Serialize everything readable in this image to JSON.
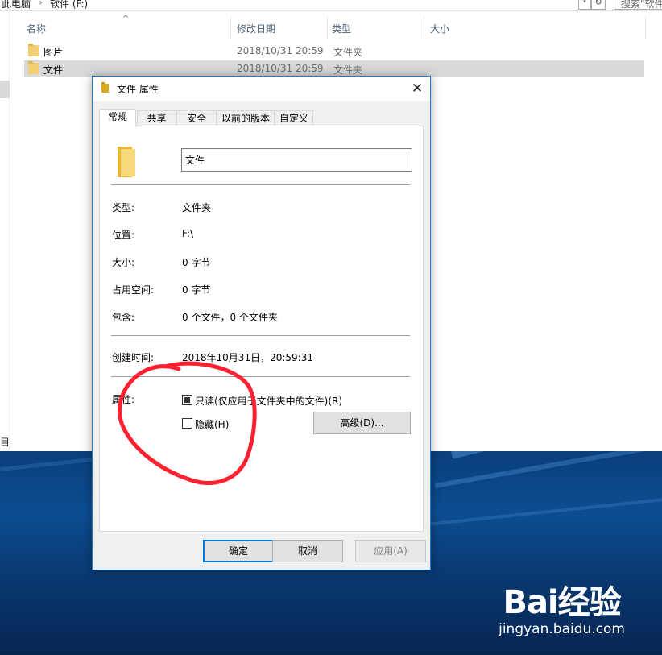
{
  "explorer": {
    "breadcrumb": [
      "此电脑",
      "软件 (F:)"
    ],
    "breadcrumb_sep": "›",
    "search_placeholder": "搜索\"软件",
    "dropdown_glyph": "∨",
    "refresh_glyph": "↻",
    "sort_glyph": "^",
    "columns": {
      "name": "名称",
      "date": "修改日期",
      "type": "类型",
      "size": "大小"
    },
    "rows": [
      {
        "name": "图片",
        "date": "2018/10/31 20:59",
        "type": "文件夹"
      },
      {
        "name": "文件",
        "date": "2018/10/31 20:59",
        "type": "文件夹"
      }
    ],
    "status_fragment": "目"
  },
  "dialog": {
    "title": "文件 属性",
    "close_glyph": "✕",
    "tabs": [
      "常规",
      "共享",
      "安全",
      "以前的版本",
      "自定义"
    ],
    "folder_name": "文件",
    "props": {
      "type_label": "类型:",
      "type_value": "文件夹",
      "location_label": "位置:",
      "location_value": "F:\\",
      "size_label": "大小:",
      "size_value": "0 字节",
      "disk_label": "占用空间:",
      "disk_value": "0 字节",
      "contains_label": "包含:",
      "contains_value": "0 个文件，0 个文件夹",
      "created_label": "创建时间:",
      "created_value": "2018年10月31日，20:59:31",
      "attributes_label": "属性:"
    },
    "attributes": {
      "readonly_label": "只读(仅应用于文件夹中的文件)(R)",
      "hidden_label": "隐藏(H)",
      "advanced_label": "高级(D)..."
    },
    "buttons": {
      "ok": "确定",
      "cancel": "取消",
      "apply": "应用(A)"
    }
  },
  "watermark": {
    "logo": "Bai经验",
    "url": "jingyan.baidu.com"
  },
  "colors": {
    "accent": "#0078d7",
    "annotation": "#ff2030",
    "folder": "#f2cf73",
    "desktop": "#0c4d92"
  }
}
